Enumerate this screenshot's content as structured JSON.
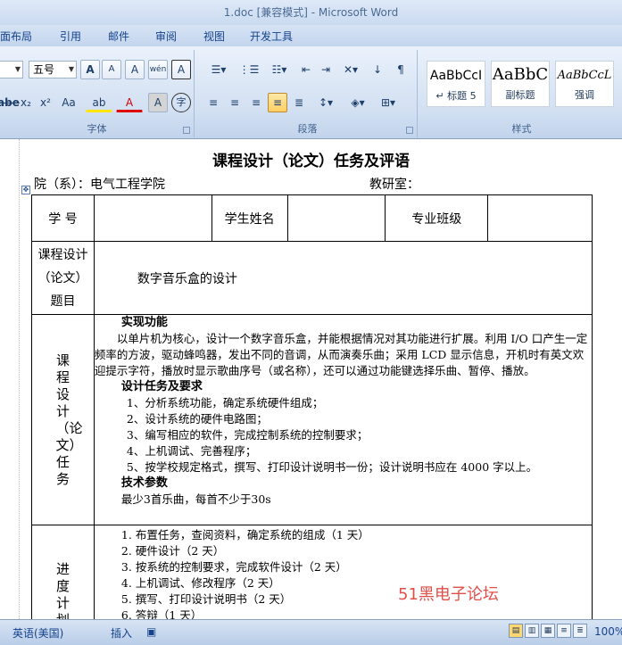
{
  "window": {
    "title": "1.doc [兼容模式] - Microsoft Word"
  },
  "ribbon_tabs": [
    "面布局",
    "引用",
    "邮件",
    "审阅",
    "视图",
    "开发工具"
  ],
  "font_group": {
    "label": "字体",
    "font_size": "五号",
    "buttons": {
      "grow": "A",
      "shrink": "A",
      "clear_format": "A",
      "phonetic": "wén",
      "char_border": "A",
      "strikethrough": "abe",
      "subscript": "x₂",
      "superscript": "x²",
      "change_case": "Aa",
      "highlight": "ab",
      "font_color": "A",
      "char_shading": "A",
      "enclose": "字"
    }
  },
  "paragraph_group": {
    "label": "段落"
  },
  "styles_group": {
    "label": "样式",
    "styles": [
      {
        "sample": "AaBbCcI",
        "name": "↵ 标题 5"
      },
      {
        "sample": "AaBbC",
        "name": "副标题"
      },
      {
        "sample": "AaBbCcL",
        "name": "强调"
      }
    ]
  },
  "document": {
    "title": "课程设计（论文）任务及评语",
    "department": "院（系）：电气工程学院",
    "staff_room": "教研室：",
    "table": {
      "student_no_label": "学 号",
      "student_name_label": "学生姓名",
      "class_label": "专业班级",
      "topic_label": [
        "课程设计",
        "（论文）",
        "题目"
      ],
      "topic_value": "数字音乐盒的设计",
      "task_label": "课程设计（论文）任务",
      "task_content": {
        "heading1": "实现功能",
        "para1": "以单片机为核心，设计一个数字音乐盒，并能根据情况对其功能进行扩展。利用 I/O 口产生一定频率的方波，驱动蜂鸣器，发出不同的音调，从而演奏乐曲；采用 LCD 显示信息，开机时有英文欢迎提示字符，播放时显示歌曲序号（或名称），还可以通过功能键选择乐曲、暂停、播放。",
        "heading2": "设计任务及要求",
        "items": [
          "1、分析系统功能，确定系统硬件组成；",
          "2、设计系统的硬件电路图；",
          "3、编写相应的软件，完成控制系统的控制要求；",
          "4、上机调试、完善程序；",
          "5、按学校规定格式，撰写、打印设计说明书一份；设计说明书应在 4000 字以上。"
        ],
        "heading3": "技术参数",
        "param": "最少3首乐曲，每首不少于30s"
      },
      "plan_label": "进度计划",
      "plan_items": [
        "1.  布置任务，查阅资料，确定系统的组成（1 天）",
        "2.  硬件设计（2 天）",
        "3.  按系统的控制要求，完成软件设计（2 天）",
        "4.  上机调试、修改程序（2 天）",
        "5.  撰写、打印设计说明书（2 天）",
        "6.  答辩（1 天）"
      ]
    },
    "watermark": "51黑电子论坛"
  },
  "status": {
    "language": "英语(美国)",
    "insert": "插入",
    "zoom": "100%"
  }
}
